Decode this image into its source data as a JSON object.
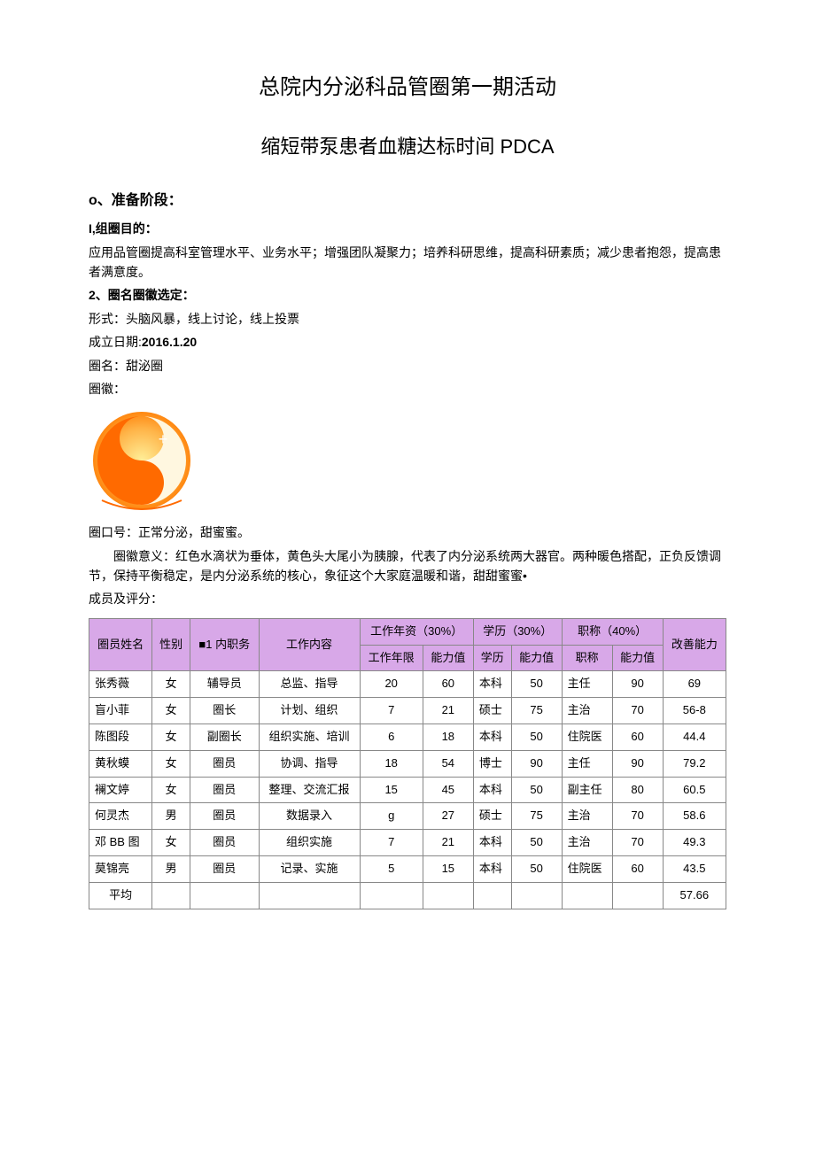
{
  "title1": "总院内分泌科品管圈第一期活动",
  "title2": "缩短带泵患者血糖达标时间 PDCA",
  "section0": {
    "head": "o、准备阶段：",
    "item1_label": "I,组圈目的：",
    "item1_text": "应用品管圈提高科室管理水平、业务水平；增强团队凝聚力；培养科研思维，提高科研素质；减少患者抱怨，提高患者满意度。",
    "item2_label": "2、圈名圈徽选定：",
    "form_line": "形式：头脑风暴，线上讨论，线上投票",
    "date_label": "成立日期:",
    "date_value": "2016.1.20",
    "circle_name": "圈名：甜泌圈",
    "circle_logo_label": "圈徽：",
    "slogan": "圈口号：正常分泌，甜蜜蜜。",
    "meaning": "圈徽意义：红色水滴状为垂体，黄色头大尾小为胰腺，代表了内分泌系统两大器官。两种暖色搭配，正负反馈调节，保持平衡稳定，是内分泌系统的核心，象征这个大家庭温暖和谐，甜甜蜜蜜•",
    "members_label": "成员及评分："
  },
  "table": {
    "headers": {
      "name": "圈员姓名",
      "gender": "性别",
      "role": "■1 内职务",
      "work": "工作内容",
      "years_group": "工作年资（30%）",
      "years": "工作年限",
      "years_val": "能力值",
      "edu_group": "学历（30%）",
      "edu": "学历",
      "edu_val": "能力值",
      "title_group": "职称（40%）",
      "title": "职称",
      "title_val": "能力值",
      "ability": "改善能力"
    },
    "rows": [
      {
        "name": "张秀薇",
        "gender": "女",
        "role": "辅导员",
        "work": "总监、指导",
        "years": "20",
        "years_val": "60",
        "edu": "本科",
        "edu_val": "50",
        "title": "主任",
        "title_val": "90",
        "ability": "69"
      },
      {
        "name": "盲小菲",
        "gender": "女",
        "role": "圈长",
        "work": "计划、组织",
        "years": "7",
        "years_val": "21",
        "edu": "硕士",
        "edu_val": "75",
        "title": "主治",
        "title_val": "70",
        "ability": "56-8"
      },
      {
        "name": "陈图段",
        "gender": "女",
        "role": "副圈长",
        "work": "组织实施、培训",
        "years": "6",
        "years_val": "18",
        "edu": "本科",
        "edu_val": "50",
        "title": "住院医",
        "title_val": "60",
        "ability": "44.4"
      },
      {
        "name": "黄秋蟆",
        "gender": "女",
        "role": "圈员",
        "work": "协调、指导",
        "years": "18",
        "years_val": "54",
        "edu": "博士",
        "edu_val": "90",
        "title": "主任",
        "title_val": "90",
        "ability": "79.2"
      },
      {
        "name": "襕文婷",
        "gender": "女",
        "role": "圈员",
        "work": "整理、交流汇报",
        "years": "15",
        "years_val": "45",
        "edu": "本科",
        "edu_val": "50",
        "title": "副主任",
        "title_val": "80",
        "ability": "60.5"
      },
      {
        "name": "何灵杰",
        "gender": "男",
        "role": "圈员",
        "work": "数据录入",
        "years": "g",
        "years_val": "27",
        "edu": "硕士",
        "edu_val": "75",
        "title": "主治",
        "title_val": "70",
        "ability": "58.6"
      },
      {
        "name": "邓 BB 图",
        "gender": "女",
        "role": "圈员",
        "work": "组织实施",
        "years": "7",
        "years_val": "21",
        "edu": "本科",
        "edu_val": "50",
        "title": "主治",
        "title_val": "70",
        "ability": "49.3"
      },
      {
        "name": "莫锦亮",
        "gender": "男",
        "role": "圈员",
        "work": "记录、实施",
        "years": "5",
        "years_val": "15",
        "edu": "本科",
        "edu_val": "50",
        "title": "住院医",
        "title_val": "60",
        "ability": "43.5"
      }
    ],
    "avg_label": "平均",
    "avg_value": "57.66"
  }
}
